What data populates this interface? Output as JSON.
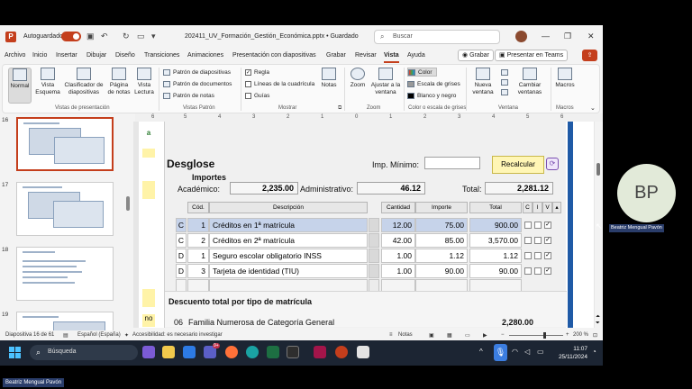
{
  "titlebar": {
    "app_icon": "powerpoint-icon",
    "autosave_label": "Autoguardado",
    "doc_title": "202411_UV_Formación_Gestión_Económica.pptx • Guardado",
    "search_placeholder": "Buscar",
    "window_controls": [
      "—",
      "❐",
      "✕"
    ]
  },
  "menu": {
    "tabs": [
      "Archivo",
      "Inicio",
      "Insertar",
      "Dibujar",
      "Diseño",
      "Transiciones",
      "Animaciones",
      "Presentación con diapositivas",
      "Grabar",
      "Revisar",
      "Vista",
      "Ayuda"
    ],
    "active_tab": "Vista",
    "grabar_button": "Grabar",
    "teams_button": "Presentar en Teams"
  },
  "ribbon": {
    "groups": {
      "vistas_presentacion": "Vistas de presentación",
      "vistas_patron": "Vistas Patrón",
      "mostrar": "Mostrar",
      "zoom": "Zoom",
      "color": "Color o escala de grises",
      "ventana": "Ventana",
      "macros": "Macros"
    },
    "buttons": {
      "normal": "Normal",
      "esquema": "Vista Esquema",
      "clasificador": "Clasificador de diapositivas",
      "pagina_notas": "Página de notas",
      "lectura": "Vista Lectura",
      "patron_diapositivas": "Patrón de diapositivas",
      "patron_documentos": "Patrón de documentos",
      "patron_notas": "Patrón de notas",
      "regla": "Regla",
      "lineas_cuadricula": "Líneas de la cuadrícula",
      "guias": "Guías",
      "notas": "Notas",
      "zoom": "Zoom",
      "ajustar": "Ajustar a la ventana",
      "color": "Color",
      "escala_grises": "Escala de grises",
      "blanco_negro": "Blanco y negro",
      "nueva_ventana": "Nueva ventana",
      "cambiar_ventanas": "Cambiar ventanas",
      "macros": "Macros"
    },
    "regla_checked": true
  },
  "ruler": [
    "6",
    "5",
    "4",
    "3",
    "2",
    "1",
    "0",
    "1",
    "2",
    "3",
    "4",
    "5",
    "6"
  ],
  "thumbnails": [
    {
      "num": "16",
      "selected": true
    },
    {
      "num": "17",
      "selected": false
    },
    {
      "num": "18",
      "selected": false
    },
    {
      "num": "19",
      "selected": false
    }
  ],
  "slide_left_tags": [
    "a",
    "no"
  ],
  "form": {
    "title": "Desglose",
    "imp_minimo_label": "Imp. Mínimo:",
    "imp_minimo_value": "",
    "recalcular": "Recalcular",
    "importes_label": "Importes",
    "academico_label": "Académico:",
    "academico_value": "2,235.00",
    "administrativo_label": "Administrativo:",
    "administrativo_value": "46.12",
    "total_label": "Total:",
    "total_value": "2,281.12",
    "columns": [
      "Cód.",
      "Descripción",
      "Cantidad",
      "Importe",
      "Total",
      "C",
      "I",
      "V"
    ],
    "rows": [
      {
        "type": "C",
        "cod": "1",
        "desc": "Créditos en 1ª matrícula",
        "cantidad": "12.00",
        "importe": "75.00",
        "total": "900.00",
        "v": "✓",
        "selected": true
      },
      {
        "type": "C",
        "cod": "2",
        "desc": "Créditos en 2ª matrícula",
        "cantidad": "42.00",
        "importe": "85.00",
        "total": "3,570.00",
        "v": "✓",
        "selected": false
      },
      {
        "type": "D",
        "cod": "1",
        "desc": "Seguro escolar obligatorio INSS",
        "cantidad": "1.00",
        "importe": "1.12",
        "total": "1.12",
        "v": "✓",
        "selected": false
      },
      {
        "type": "D",
        "cod": "3",
        "desc": "Tarjeta de identidad (TIU)",
        "cantidad": "1.00",
        "importe": "90.00",
        "total": "90.00",
        "v": "✓",
        "selected": false
      }
    ],
    "section_title": "Descuento total por tipo de matrícula",
    "partial_row_code": "06",
    "partial_row_desc": "Familia Numerosa de Categoría General",
    "partial_row_total": "2,280.00"
  },
  "statusbar": {
    "slide_info": "Diapositiva 16 de 61",
    "language": "Español (España)",
    "accessibility": "Accesibilidad: es necesario investigar",
    "notes": "Notas",
    "zoom": "200 %"
  },
  "taskbar": {
    "search_placeholder": "Búsqueda",
    "time": "11:07",
    "date": "25/11/2024",
    "badge": "9+"
  },
  "participant": {
    "initials": "BP",
    "name": "Beatriz Mengual Pavón"
  },
  "self_view_name": "Beatriz Mengual Pavón"
}
